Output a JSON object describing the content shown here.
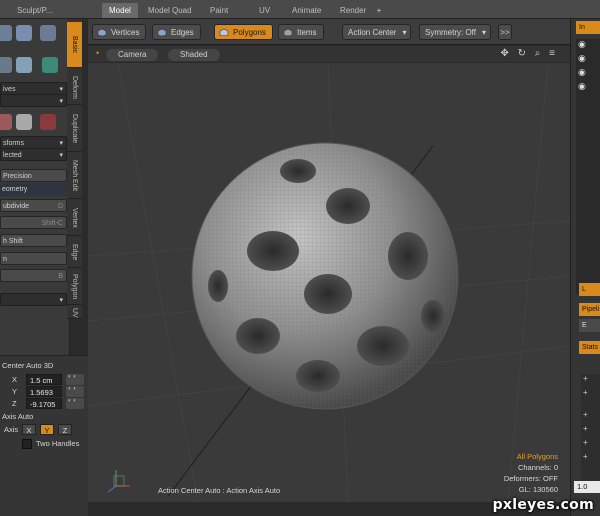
{
  "tabs": [
    {
      "label": "Sculpt/P..."
    },
    {
      "label": "Model",
      "active": true
    },
    {
      "label": "Model Quad"
    },
    {
      "label": "Paint"
    },
    {
      "label": "UV"
    },
    {
      "label": "Animate"
    },
    {
      "label": "Render"
    }
  ],
  "tab_add": "+",
  "toolbar": {
    "vertices": "Vertices",
    "edges": "Edges",
    "polygons": "Polygons",
    "items": "Items",
    "action_center": "Action Center",
    "symmetry": "Symmetry: Off",
    "more": ">>"
  },
  "side_tabs": [
    "Basic",
    "Deform",
    "Duplicate",
    "Mesh Edit",
    "Vertex",
    "Edge",
    "Polygon",
    "UV"
  ],
  "left_panel": {
    "dd_primitives": "ives",
    "dd_transforms": "sforms",
    "dd_selected": "lected",
    "precision": "Precision",
    "geometry_header": "eometry",
    "subdivide": "ubdivide",
    "subdivide_shortcut": "D",
    "shift_c": "Shift-C",
    "h_shift": "h Shift",
    "n_row": "n",
    "b_row": "B"
  },
  "lower_left": {
    "center_label": "Center Auto 3D",
    "x_label": "X",
    "x_value": "1.5 cm",
    "y_label": "Y",
    "y_value": "1.5693",
    "z_label": "Z",
    "z_value": "-9.1705",
    "axis_auto": "Axis Auto",
    "axis_label": "Axis",
    "axis_x": "X",
    "axis_y": "Y",
    "axis_z": "Z",
    "two_handles": "Two Handles"
  },
  "viewport": {
    "camera": "Camera",
    "shaded": "Shaded",
    "controls": "✥ ↻ ⌕ ≡",
    "all_polygons": "All Polygons",
    "channels": "Channels: 0",
    "deformers": "Deformers: OFF",
    "gl": "GL: 130560",
    "status": "Action Center Auto : Action Axis Auto"
  },
  "right_panel": {
    "tab_top": "In",
    "tab_mid": "L",
    "tab_pipeline": "Pipeli",
    "tab_e": "E",
    "tab_stats": "Stats",
    "field_value": "1.0"
  },
  "watermark": "pxleyes.com",
  "colors": {
    "accent": "#d98a1a",
    "info_accent": "#e0a030",
    "viewport_bg": "#3a3a3a",
    "mesh": "#9a9a9a"
  }
}
